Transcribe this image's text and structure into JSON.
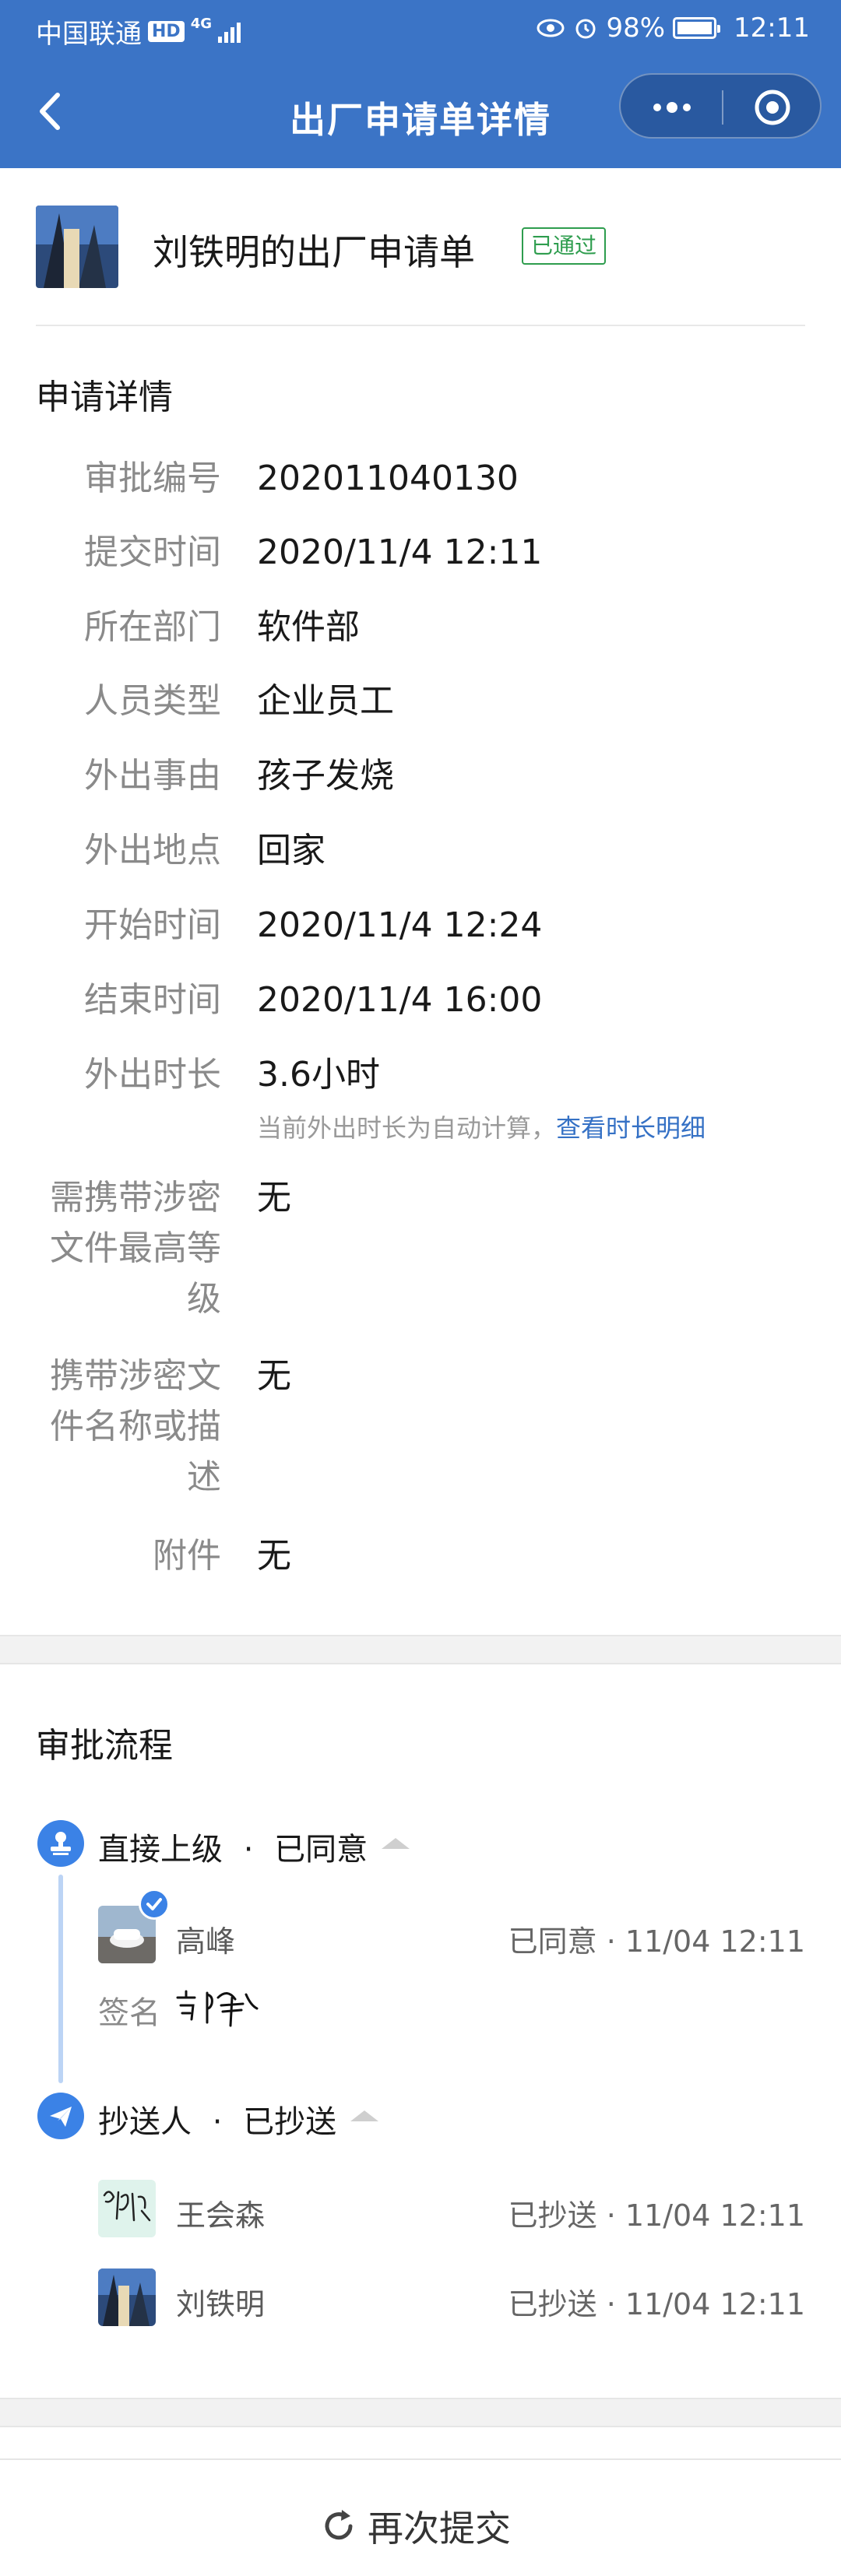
{
  "status_bar": {
    "carrier": "中国联通",
    "hd": "HD",
    "network": "4G",
    "battery": "98%",
    "time": "12:11"
  },
  "nav": {
    "title": "出厂申请单详情",
    "back_icon": "chevron-left-icon",
    "menu_icon": "more-dots-icon",
    "close_icon": "target-close-icon"
  },
  "header": {
    "title": "刘铁明的出厂申请单",
    "status_badge": "已通过",
    "badge_color": "#2e9d4e"
  },
  "details": {
    "section_title": "申请详情",
    "rows": [
      {
        "label": "审批编号",
        "value": "202011040130"
      },
      {
        "label": "提交时间",
        "value": "2020/11/4 12:11"
      },
      {
        "label": "所在部门",
        "value": "软件部"
      },
      {
        "label": "人员类型",
        "value": "企业员工"
      },
      {
        "label": "外出事由",
        "value": "孩子发烧"
      },
      {
        "label": "外出地点",
        "value": "回家"
      },
      {
        "label": "开始时间",
        "value": "2020/11/4 12:24"
      },
      {
        "label": "结束时间",
        "value": "2020/11/4 16:00"
      },
      {
        "label": "外出时长",
        "value": "3.6小时"
      }
    ],
    "duration_hint": "当前外出时长为自动计算，",
    "duration_link": "查看时长明细",
    "secret_level": {
      "label_l1": "需携带涉密",
      "label_l2": "文件最高等",
      "label_l3": "级",
      "value": "无"
    },
    "secret_desc": {
      "label_l1": "携带涉密文",
      "label_l2": "件名称或描",
      "label_l3": "述",
      "value": "无"
    },
    "attachment": {
      "label": "附件",
      "value": "无"
    }
  },
  "flow": {
    "section_title": "审批流程",
    "step1": {
      "title": "直接上级",
      "dot": "·",
      "status": "已同意",
      "person_name": "高峰",
      "person_status": "已同意 · 11/04 12:11",
      "sign_label": "签名"
    },
    "step2": {
      "title": "抄送人",
      "dot": "·",
      "status": "已抄送",
      "persons": [
        {
          "name": "王会森",
          "status": "已抄送 · 11/04 12:11"
        },
        {
          "name": "刘铁明",
          "status": "已抄送 · 11/04 12:11"
        }
      ]
    }
  },
  "footer": {
    "resubmit_label": "再次提交"
  },
  "colors": {
    "primary": "#3b74c6",
    "accent_blue": "#3b82e6",
    "link": "#3571c5",
    "success": "#2e9d4e"
  }
}
